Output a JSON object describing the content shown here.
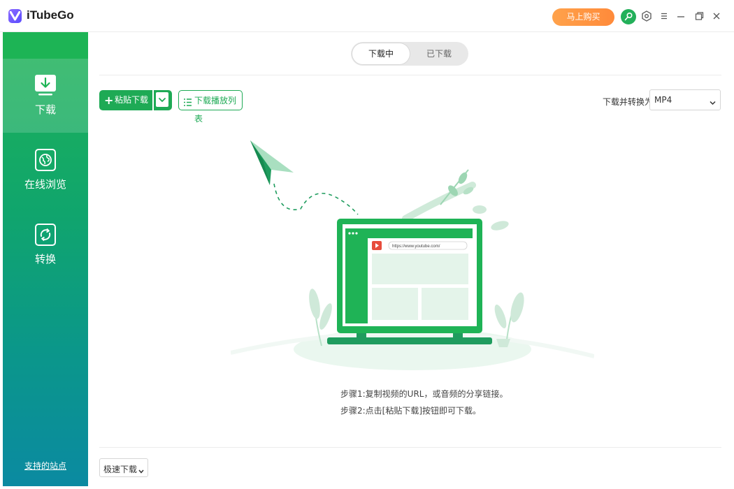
{
  "app": {
    "title": "iTubeGo",
    "buy_label": "马上购买"
  },
  "sidebar": {
    "items": [
      {
        "label": "下载",
        "icon": "download-icon",
        "active": true
      },
      {
        "label": "在线浏览",
        "icon": "browser-icon",
        "active": false
      },
      {
        "label": "转换",
        "icon": "convert-icon",
        "active": false
      }
    ],
    "supported_sites": "支持的站点"
  },
  "tabs": {
    "downloading": "下载中",
    "downloaded": "已下载"
  },
  "toolbar": {
    "paste_label": "粘贴下载",
    "playlist_label": "下载播放列表",
    "convert_to_label": "下载并转换为",
    "format_value": "MP4"
  },
  "illustration": {
    "url_text": "https://www.youtube.com/"
  },
  "steps": {
    "step1": "步骤1:复制视频的URL，或音频的分享链接。",
    "step2": "步骤2:点击[粘贴下载]按钮即可下载。"
  },
  "footer": {
    "speed_value": "极速下载"
  },
  "colors": {
    "accent": "#1eaa55",
    "buy": "#ff9a45"
  }
}
